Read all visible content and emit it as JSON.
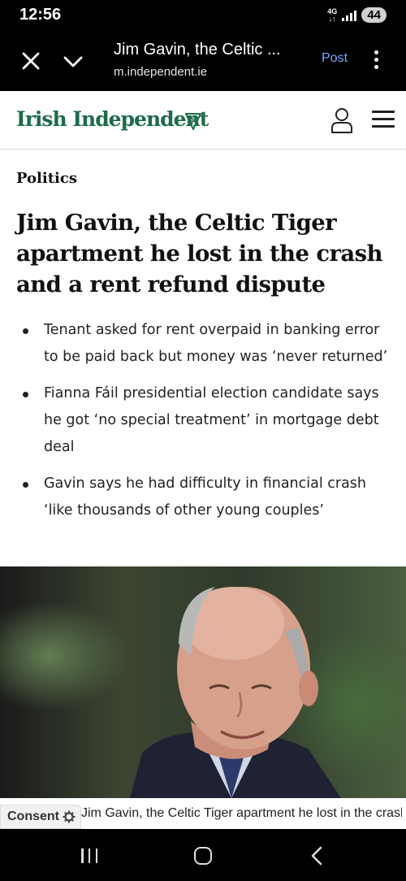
{
  "status": {
    "time": "12:56",
    "network_top": "4G",
    "network_bottom": "↓↑",
    "battery": "44"
  },
  "browser": {
    "title": "Jim Gavin, the Celtic ...",
    "url": "m.independent.ie",
    "post_label": "Post"
  },
  "site": {
    "logo": "Irish Independent",
    "brand_color": "#1d6b4b"
  },
  "article": {
    "category": "Politics",
    "headline": "Jim Gavin, the Celtic Tiger apartment he lost in the crash and a rent refund dispute",
    "bullets": [
      "Tenant asked for rent overpaid in banking error to be paid back but money was ‘never returned’",
      "Fianna Fáil presidential election candidate says he got ‘no special treatment’ in mortgage debt deal",
      "Gavin says he had difficulty in financial crash ‘like thousands of other young couples’"
    ],
    "caption": "Jim Gavin, the Celtic Tiger apartment he lost in the crash and a rent refund dispute"
  },
  "consent": {
    "label": "Consent"
  },
  "icons": [
    "close-icon",
    "collapse-icon",
    "kebab-icon",
    "harp-icon",
    "user-icon",
    "menu-icon",
    "gear-icon",
    "recents-icon",
    "home-icon",
    "back-icon"
  ]
}
